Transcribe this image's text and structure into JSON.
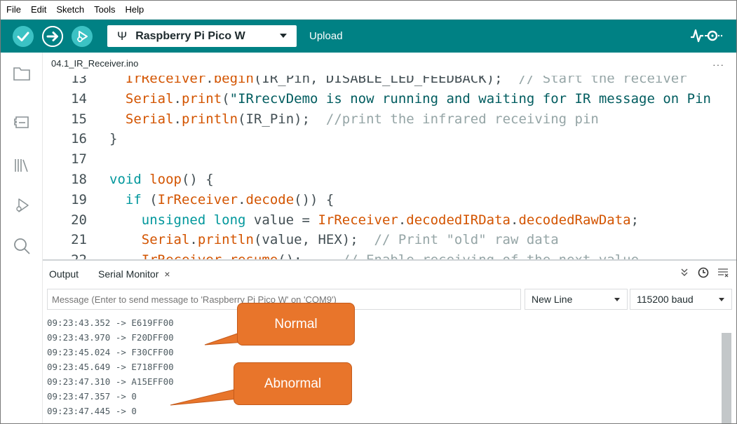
{
  "menu": [
    "File",
    "Edit",
    "Sketch",
    "Tools",
    "Help"
  ],
  "toolbar": {
    "board": "Raspberry Pi Pico W",
    "upload_label": "Upload",
    "verify_icon": "check-icon",
    "upload_icon": "arrow-right-icon",
    "debug_icon": "debug-icon"
  },
  "editor": {
    "tab": "04.1_IR_Receiver.ino",
    "more": "···",
    "lines": [
      {
        "n": "13",
        "indent": "  ",
        "parts": [
          [
            "cls",
            "IrReceiver"
          ],
          [
            "",
            "."
          ],
          [
            "fn",
            "begin"
          ],
          [
            "",
            "(IR_Pin, DISABLE_LED_FEEDBACK);  "
          ],
          [
            "cm",
            "// Start the receiver"
          ]
        ]
      },
      {
        "n": "14",
        "indent": "  ",
        "parts": [
          [
            "cls",
            "Serial"
          ],
          [
            "",
            "."
          ],
          [
            "fn",
            "print"
          ],
          [
            "",
            "("
          ],
          [
            "str",
            "\"IRrecvDemo is now running and waiting for IR message on Pin "
          ],
          [
            "",
            ""
          ]
        ]
      },
      {
        "n": "15",
        "indent": "  ",
        "parts": [
          [
            "cls",
            "Serial"
          ],
          [
            "",
            "."
          ],
          [
            "fn",
            "println"
          ],
          [
            "",
            "(IR_Pin);  "
          ],
          [
            "cm",
            "//print the infrared receiving pin"
          ]
        ]
      },
      {
        "n": "16",
        "indent": "",
        "parts": [
          [
            "",
            "}"
          ]
        ]
      },
      {
        "n": "17",
        "indent": "",
        "parts": []
      },
      {
        "n": "18",
        "indent": "",
        "parts": [
          [
            "kw",
            "void"
          ],
          [
            "",
            " "
          ],
          [
            "fn",
            "loop"
          ],
          [
            "",
            "() {"
          ]
        ]
      },
      {
        "n": "19",
        "indent": "  ",
        "parts": [
          [
            "kw",
            "if"
          ],
          [
            "",
            " ("
          ],
          [
            "cls",
            "IrReceiver"
          ],
          [
            "",
            "."
          ],
          [
            "fn",
            "decode"
          ],
          [
            "",
            "()) {"
          ]
        ]
      },
      {
        "n": "20",
        "indent": "    ",
        "parts": [
          [
            "kw",
            "unsigned long"
          ],
          [
            "",
            " value = "
          ],
          [
            "cls",
            "IrReceiver"
          ],
          [
            "",
            "."
          ],
          [
            "fn",
            "decodedIRData"
          ],
          [
            "",
            "."
          ],
          [
            "fn",
            "decodedRawData"
          ],
          [
            "",
            ";"
          ]
        ]
      },
      {
        "n": "21",
        "indent": "    ",
        "parts": [
          [
            "cls",
            "Serial"
          ],
          [
            "",
            "."
          ],
          [
            "fn",
            "println"
          ],
          [
            "",
            "(value, HEX);  "
          ],
          [
            "cm",
            "// Print \"old\" raw data"
          ]
        ]
      },
      {
        "n": "22",
        "indent": "    ",
        "parts": [
          [
            "cls",
            "IrReceiver"
          ],
          [
            "",
            "."
          ],
          [
            "fn",
            "resume"
          ],
          [
            "",
            "();     "
          ],
          [
            "cm",
            "// Enable receiving of the next value"
          ]
        ]
      }
    ]
  },
  "panel": {
    "output_tab": "Output",
    "serial_tab": "Serial Monitor",
    "close": "×",
    "message_placeholder": "Message (Enter to send message to 'Raspberry Pi Pico W' on 'COM9')",
    "line_ending": "New Line",
    "baud": "115200 baud",
    "lines": [
      "09:23:43.352 -> E619FF00",
      "09:23:43.970 -> F20DFF00",
      "09:23:45.024 -> F30CFF00",
      "09:23:45.649 -> E718FF00",
      "09:23:47.310 -> A15EFF00",
      "09:23:47.357 -> 0",
      "09:23:47.445 -> 0"
    ]
  },
  "callouts": {
    "normal": "Normal",
    "abnormal": "Abnormal"
  },
  "colors": {
    "toolbar": "#008184",
    "button": "#3cc2c4",
    "callout": "#e8752b"
  }
}
